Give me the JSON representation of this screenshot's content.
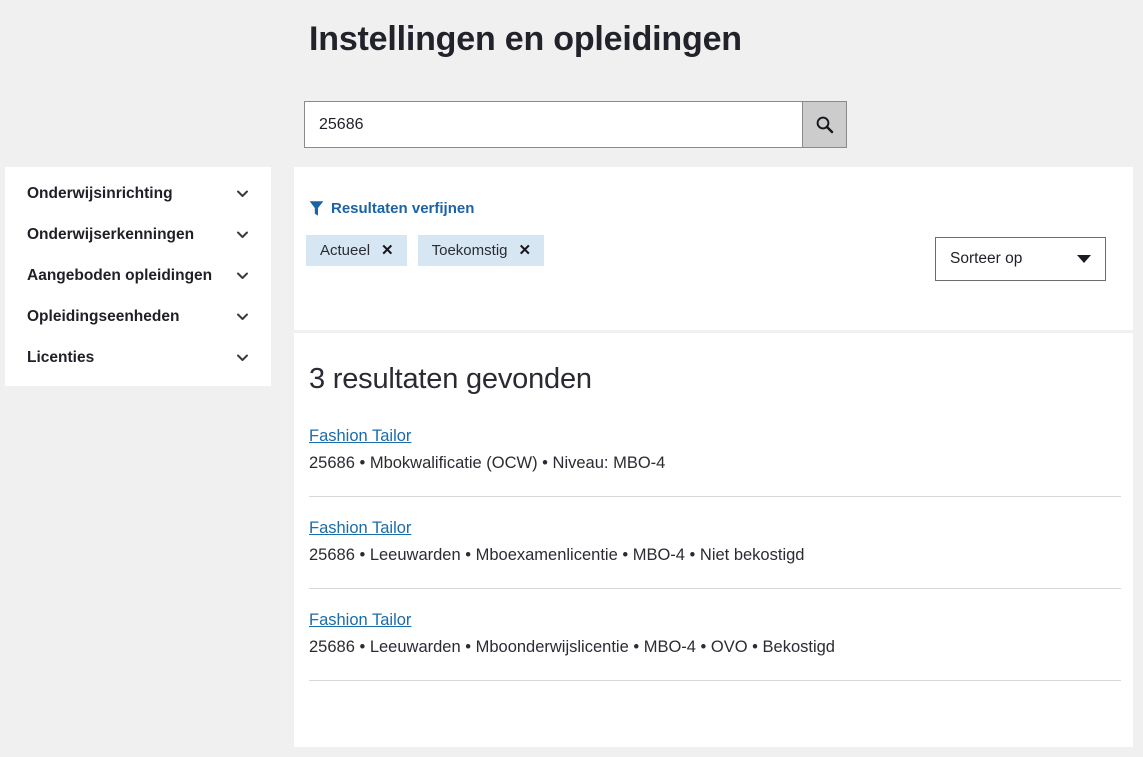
{
  "page": {
    "title": "Instellingen en opleidingen",
    "background_color": "#f0f0f0"
  },
  "search": {
    "value": "25686",
    "placeholder": "",
    "button_icon": "search-icon"
  },
  "sidebar": {
    "items": [
      {
        "label": "Onderwijsinrichting",
        "icon": "chevron-down-icon"
      },
      {
        "label": "Onderwijserkenningen",
        "icon": "chevron-down-icon"
      },
      {
        "label": "Aangeboden opleidingen",
        "icon": "chevron-down-icon"
      },
      {
        "label": "Opleidingseenheden",
        "icon": "chevron-down-icon"
      },
      {
        "label": "Licenties",
        "icon": "chevron-down-icon"
      }
    ]
  },
  "filters": {
    "refine_label": "Resultaten verfijnen",
    "refine_icon": "filter-funnel-icon",
    "refine_color": "#1b63a5",
    "chips": [
      {
        "label": "Actueel",
        "close_icon": "close-icon",
        "background": "#d7e6f3"
      },
      {
        "label": "Toekomstig",
        "close_icon": "close-icon",
        "background": "#d7e6f3"
      }
    ],
    "sort": {
      "label": "Sorteer op",
      "icon": "caret-down-icon"
    }
  },
  "results": {
    "heading": "3 resultaten gevonden",
    "link_color": "#1b6ca8",
    "items": [
      {
        "title": "Fashion Tailor",
        "meta": "25686  •  Mbokwalificatie (OCW)  •  Niveau: MBO-4"
      },
      {
        "title": "Fashion Tailor",
        "meta": "25686  •  Leeuwarden  •  Mboexamenlicentie  •  MBO-4  •  Niet bekostigd"
      },
      {
        "title": "Fashion Tailor",
        "meta": "25686  •  Leeuwarden  •  Mboonderwijslicentie  •  MBO-4  •  OVO  •  Bekostigd"
      }
    ]
  }
}
